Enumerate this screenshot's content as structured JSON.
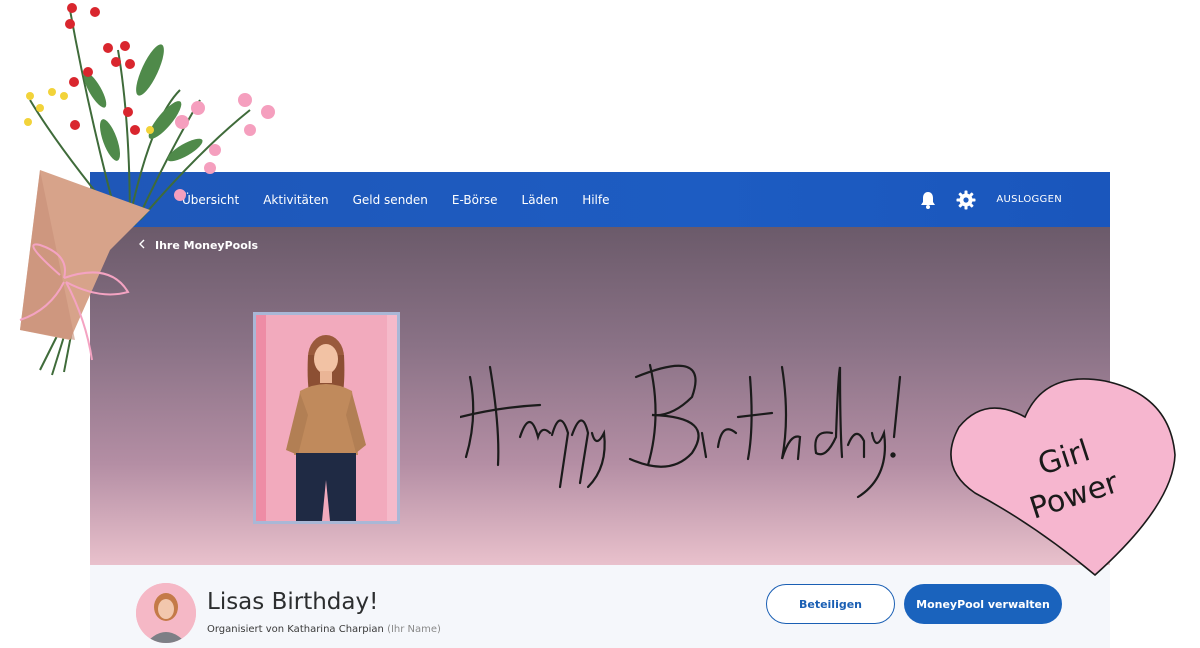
{
  "nav": {
    "items": [
      "Übersicht",
      "Aktivitäten",
      "Geld senden",
      "E-Börse",
      "Läden",
      "Hilfe"
    ],
    "logout_label": "AUSLOGGEN",
    "bell_icon": "bell-icon",
    "settings_icon": "gear-icon"
  },
  "banner": {
    "breadcrumb": "Ihre MoneyPools",
    "script_text": "Happy Birthday!"
  },
  "pool": {
    "title": "Lisas Birthday!",
    "organizer_prefix": "Organisiert von Katharina Charpian",
    "organizer_suffix": "(Ihr Name)",
    "join_label": "Beteiligen",
    "manage_label": "MoneyPool verwalten"
  },
  "decor": {
    "heart_line1": "Girl",
    "heart_line2": "Power"
  },
  "colors": {
    "nav_blue": "#1d5cc2",
    "button_blue": "#1a63bd",
    "heart_pink": "#f6b6cf"
  }
}
